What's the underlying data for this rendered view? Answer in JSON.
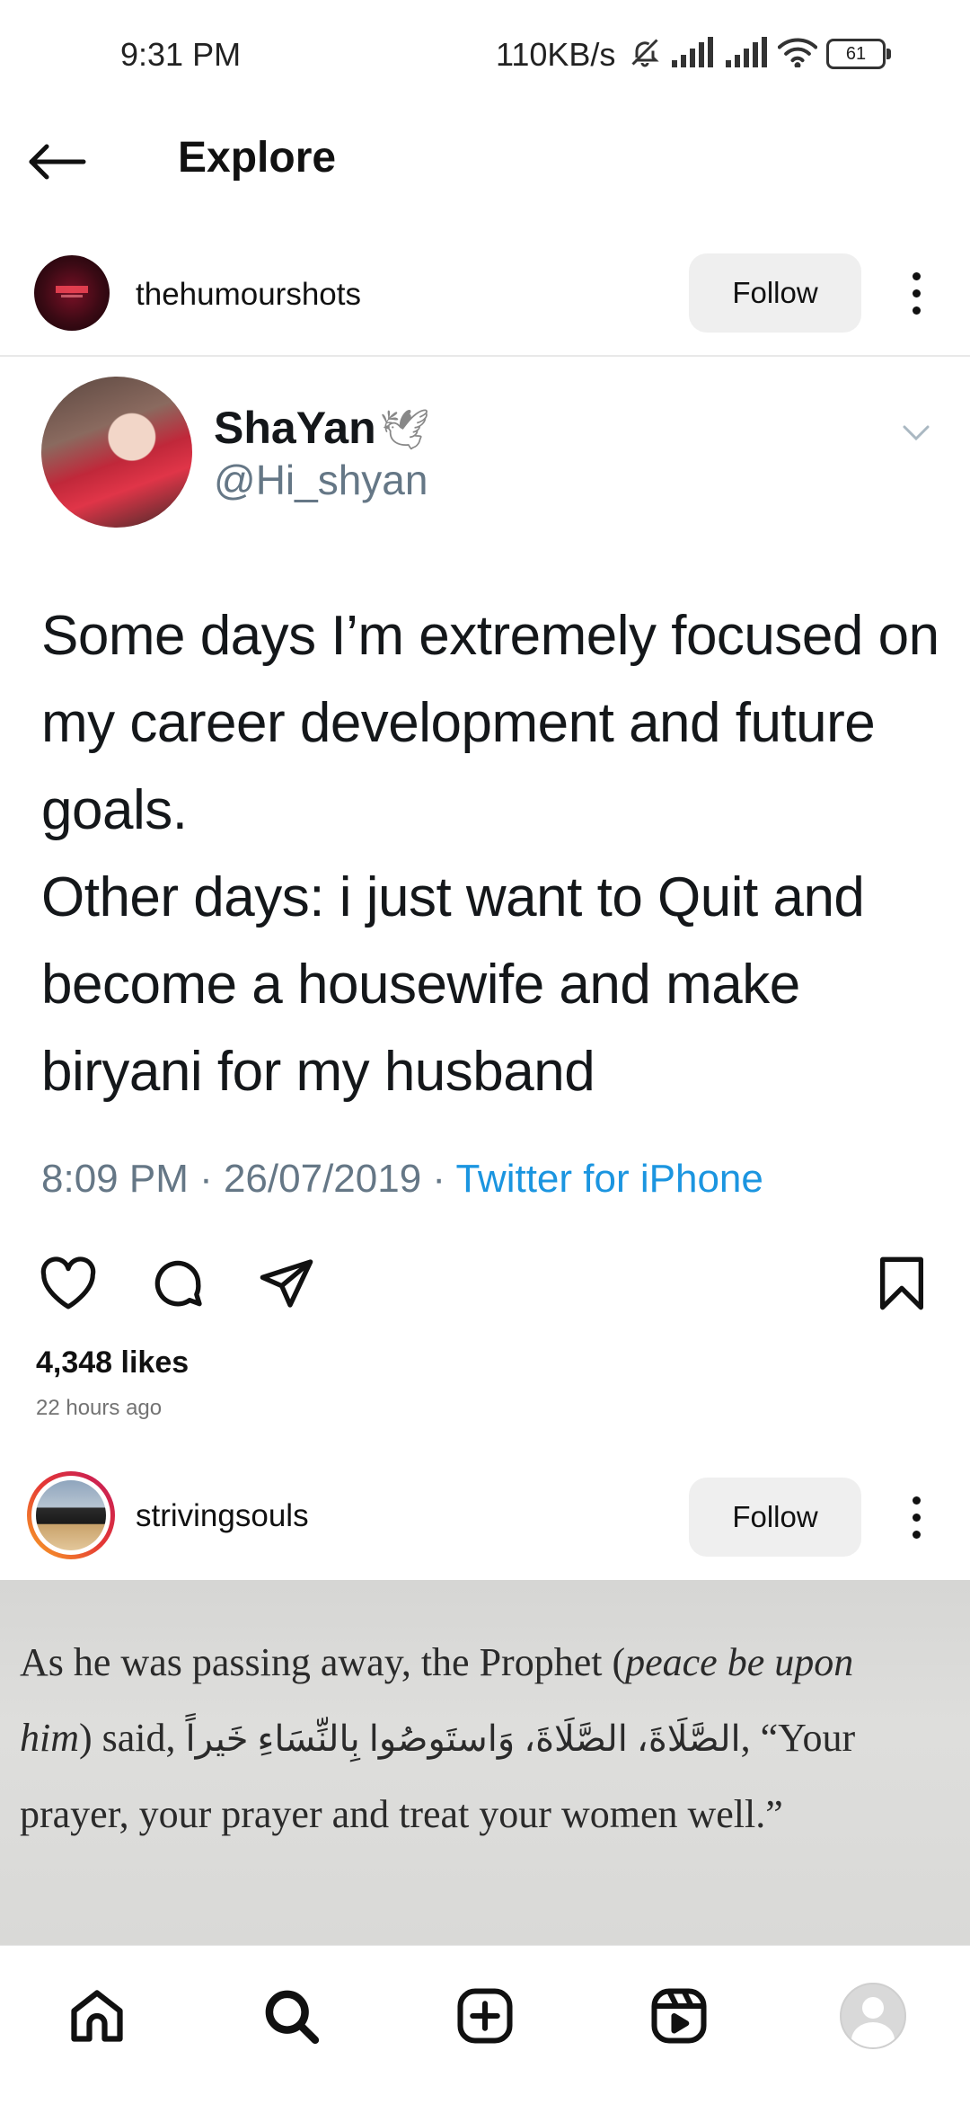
{
  "status_bar": {
    "time": "9:31 PM",
    "network_speed": "110KB/s",
    "battery": "61",
    "icons": [
      "mute-icon",
      "signal-icon",
      "signal-icon",
      "wifi-icon",
      "battery-icon"
    ]
  },
  "header": {
    "back_icon": "arrow-left-icon",
    "title": "Explore"
  },
  "posts": [
    {
      "username": "thehumourshots",
      "follow_label": "Follow",
      "tweet": {
        "name": "ShaYan",
        "name_emoji": "🕊",
        "handle": "@Hi_shyan",
        "text": "Some days I’m extremely focused on my career development and future goals.\nOther days: i just want to Quit and become a housewife and make biryani for my husband",
        "timestamp": "8:09 PM · 26/07/2019 · ",
        "source": "Twitter for iPhone"
      },
      "likes": "4,348 likes",
      "time_ago": "22 hours ago"
    },
    {
      "username": "strivingsouls",
      "follow_label": "Follow",
      "image_text": {
        "line1_a": "As he was passing away, the Prophet (",
        "line1_b": "peace be upon",
        "line2_a": "him",
        "line2_b": ") said, ",
        "line2_arabic": "الصَّلَاةَ، الصَّلَاةَ، وَاستَوصُوا بِالنِّسَاءِ خَيراً",
        "line2_c": ", “Your",
        "line3": "prayer, your prayer and treat your women well.”"
      }
    }
  ],
  "bottom_nav": {
    "items": [
      "home-icon",
      "search-icon",
      "create-icon",
      "reels-icon",
      "profile-icon"
    ]
  },
  "colors": {
    "twitter_link": "#1b95e0",
    "follow_bg": "#efefef",
    "story_ring_start": "#f9a825",
    "story_ring_end": "#c2185b"
  }
}
